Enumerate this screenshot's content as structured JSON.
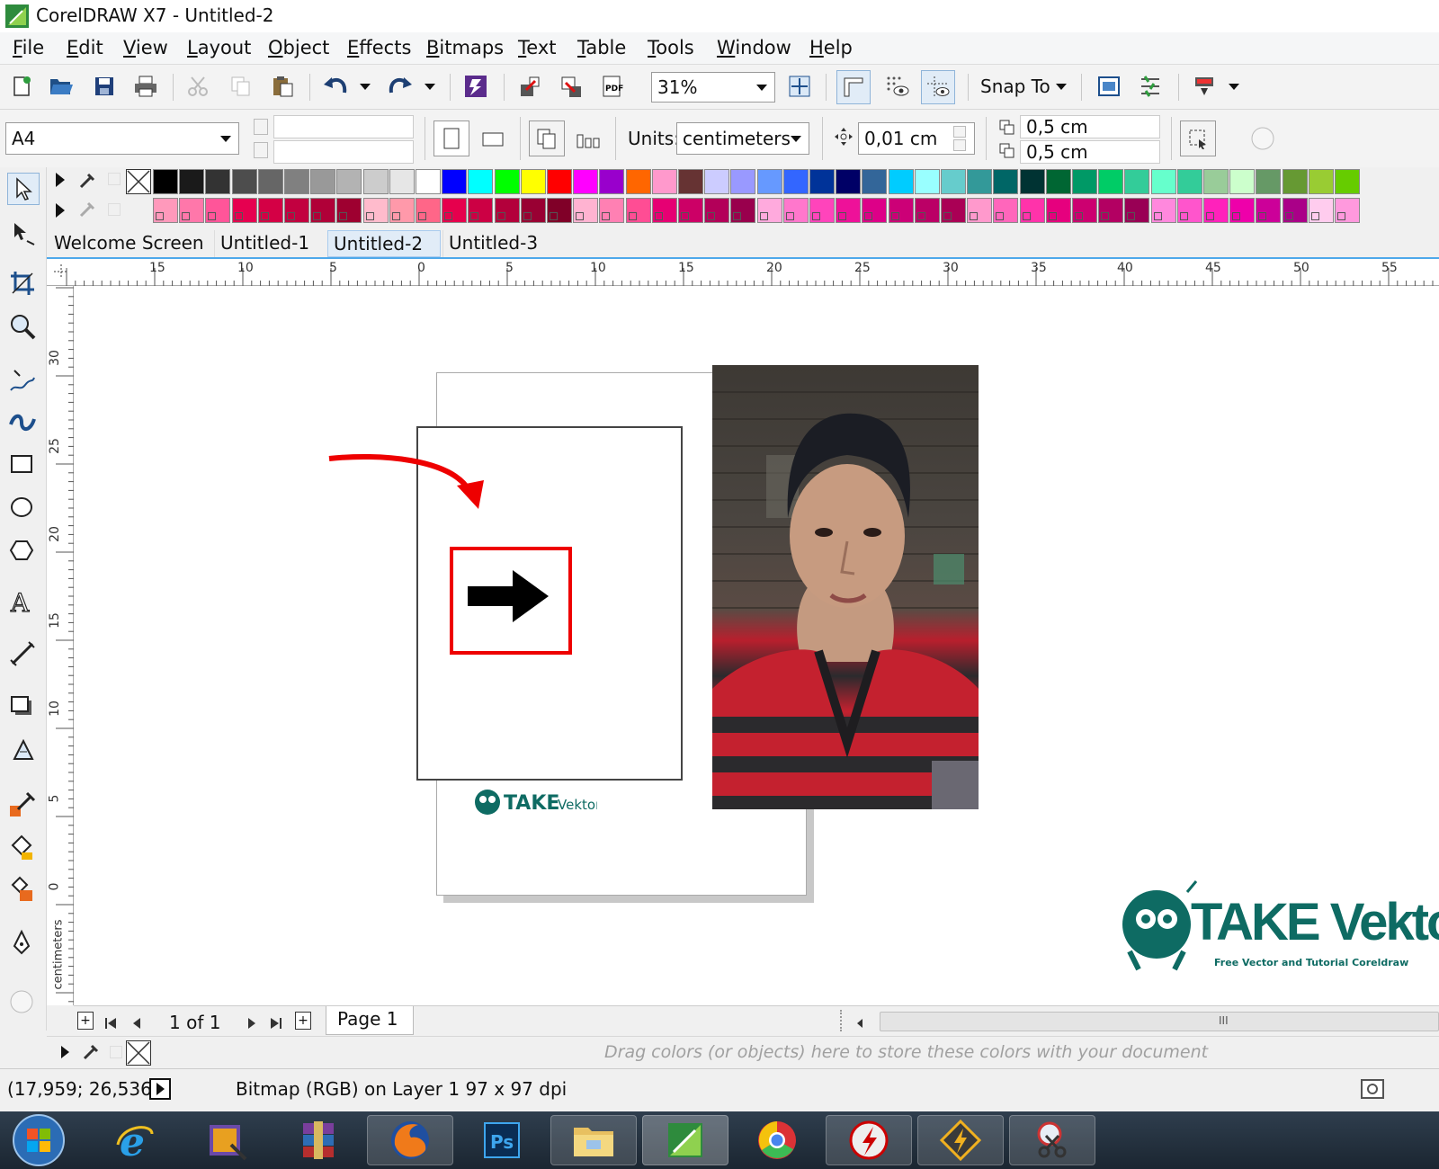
{
  "window": {
    "title": "CorelDRAW X7 - Untitled-2"
  },
  "menu": [
    "File",
    "Edit",
    "View",
    "Layout",
    "Object",
    "Effects",
    "Bitmaps",
    "Text",
    "Table",
    "Tools",
    "Window",
    "Help"
  ],
  "toolbar": {
    "zoom": "31%",
    "snap_label": "Snap To"
  },
  "propertybar": {
    "page_size": "A4",
    "units_label": "Units:",
    "units_value": "centimeters",
    "nudge": "0,01 cm",
    "dup_x": "0,5 cm",
    "dup_y": "0,5 cm"
  },
  "tabs": [
    "Welcome Screen",
    "Untitled-1",
    "Untitled-2",
    "Untitled-3"
  ],
  "active_tab": "Untitled-2",
  "rulers": {
    "horizontal": [
      "15",
      "10",
      "5",
      "0",
      "5",
      "10",
      "15",
      "20",
      "25",
      "30",
      "35",
      "40",
      "45",
      "50",
      "55"
    ],
    "vertical": [
      "30",
      "25",
      "20",
      "15",
      "10",
      "5",
      "0"
    ],
    "units_label": "centimeters"
  },
  "watermark": {
    "brand": "TAKE Vektor",
    "tagline": "Free Vector and Tutorial Coreldraw"
  },
  "pagebar": {
    "page_count": "1 of 1",
    "page_tab": "Page 1"
  },
  "docpalette_hint": "Drag colors (or objects) here to store these colors with your document",
  "status": {
    "coords": "(17,959; 26,536 )",
    "info": "Bitmap (RGB) on Layer 1 97 x 97 dpi"
  },
  "palette_top": [
    "#000000",
    "#1a1a1a",
    "#333333",
    "#4d4d4d",
    "#666666",
    "#808080",
    "#999999",
    "#b3b3b3",
    "#cccccc",
    "#e6e6e6",
    "#ffffff",
    "#0000ff",
    "#00ffff",
    "#00ff00",
    "#ffff00",
    "#ff0000",
    "#ff00ff",
    "#9900cc",
    "#ff6600",
    "#ff99cc",
    "#663333",
    "#ccccff",
    "#9999ff",
    "#6699ff",
    "#3366ff",
    "#003399",
    "#000066",
    "#336699",
    "#00ccff",
    "#99ffff",
    "#66cccc",
    "#339999",
    "#006666",
    "#003333",
    "#006633",
    "#009966",
    "#00cc66",
    "#33cc99",
    "#66ffcc",
    "#33cc99",
    "#99cc99",
    "#ccffcc",
    "#669966",
    "#669933",
    "#99cc33",
    "#66cc00"
  ],
  "palette_bottom": [
    "#ff99bb",
    "#ff77aa",
    "#ff5599",
    "#e60050",
    "#d40045",
    "#c20040",
    "#b00038",
    "#9e0030",
    "#ffbbcc",
    "#ff99aa",
    "#ff6688",
    "#e6004d",
    "#cc0044",
    "#b3003b",
    "#990033",
    "#800028",
    "#ffb3d1",
    "#ff80b3",
    "#ff4d94",
    "#e60073",
    "#cc0066",
    "#b30059",
    "#99004d",
    "#ffaadd",
    "#ff77cc",
    "#ff44bb",
    "#ee1199",
    "#dd0088",
    "#cc0077",
    "#bb0066",
    "#aa0055",
    "#ff99cc",
    "#ff66bb",
    "#ff33aa",
    "#e6007e",
    "#cc0070",
    "#b30062",
    "#990055",
    "#ff88dd",
    "#ff55cc",
    "#ff22bb",
    "#ee00aa",
    "#cc0099",
    "#aa0088",
    "#ffccee",
    "#ff99dd"
  ]
}
